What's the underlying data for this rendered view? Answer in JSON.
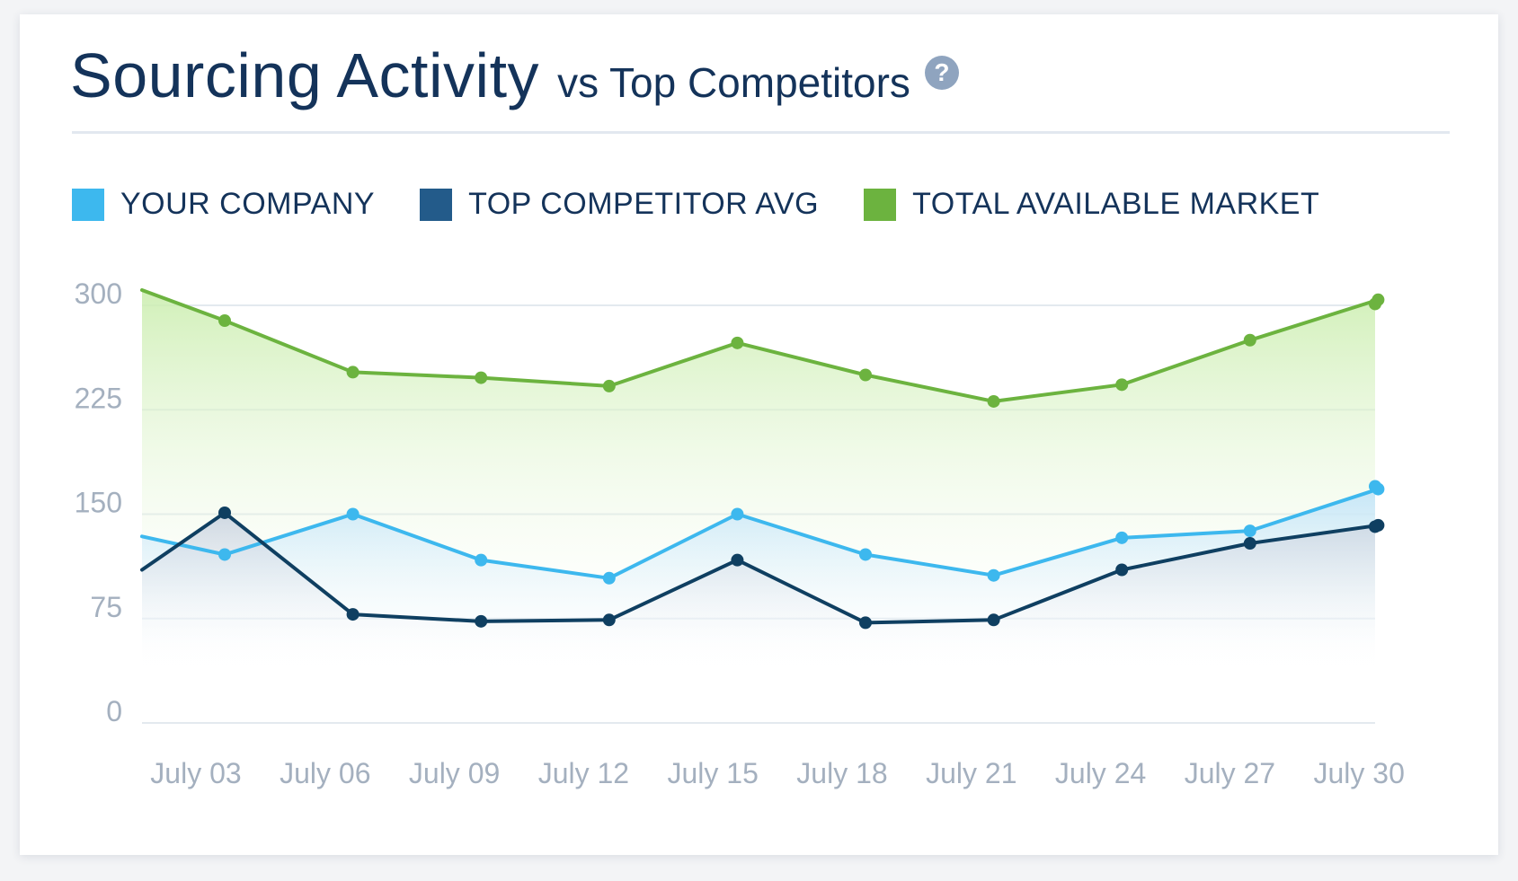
{
  "header": {
    "title": "Sourcing Activity",
    "subtitle": "vs Top Competitors",
    "help_icon": "question-circle-icon"
  },
  "legend": [
    {
      "label": "YOUR COMPANY",
      "color": "#3db8ee"
    },
    {
      "label": "TOP COMPETITOR AVG",
      "color": "#235b8a"
    },
    {
      "label": "TOTAL AVAILABLE MARKET",
      "color": "#6cb33f"
    }
  ],
  "chart_data": {
    "type": "area",
    "categories": [
      "July 03",
      "July 06",
      "July 09",
      "July 12",
      "July 15",
      "July 18",
      "July 21",
      "July 24",
      "July 27",
      "July 30"
    ],
    "yticks": [
      "0",
      "75",
      "150",
      "225",
      "300"
    ],
    "ylim": [
      0,
      300
    ],
    "grid": true,
    "legend_position": "top",
    "series": [
      {
        "name": "TOTAL AVAILABLE MARKET",
        "color": "#6cb33f",
        "edge_start": 311,
        "edge_end": 301,
        "values": [
          289,
          252,
          248,
          242,
          273,
          250,
          231,
          243,
          275,
          304
        ]
      },
      {
        "name": "YOUR COMPANY",
        "color": "#3db8ee",
        "edge_start": 134,
        "edge_end": 170,
        "values": [
          121,
          150,
          117,
          104,
          150,
          121,
          106,
          133,
          138,
          168
        ]
      },
      {
        "name": "TOP COMPETITOR AVG",
        "color": "#0f3f61",
        "edge_start": 110,
        "edge_end": 141,
        "values": [
          151,
          78,
          73,
          74,
          117,
          72,
          74,
          110,
          129,
          142
        ]
      }
    ]
  }
}
